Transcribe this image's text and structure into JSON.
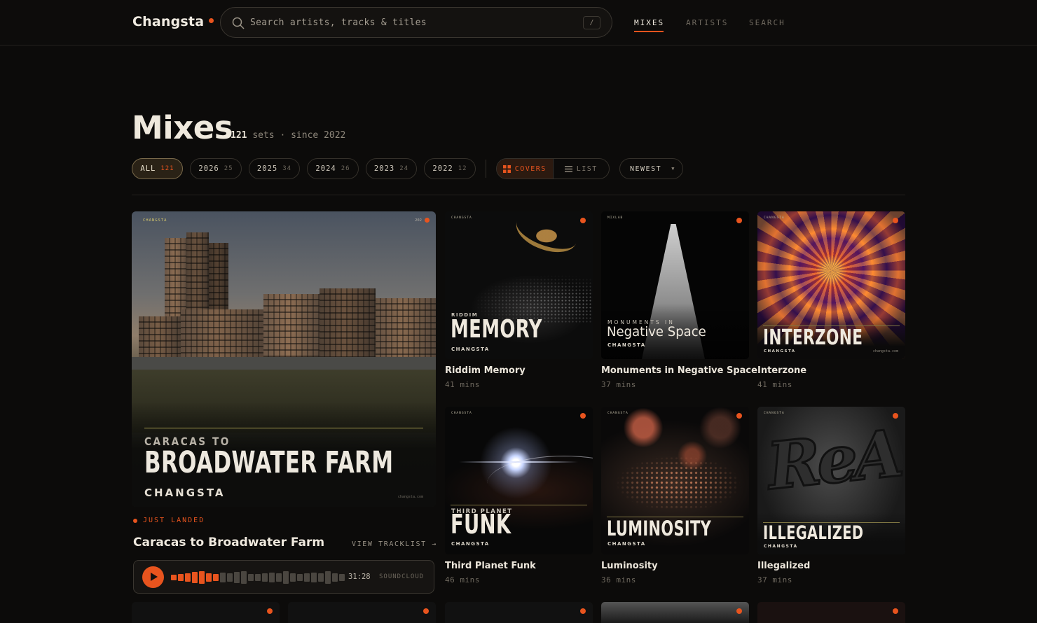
{
  "brand": {
    "name": "Changsta"
  },
  "search": {
    "placeholder": "Search artists, tracks & titles",
    "shortcut": "/"
  },
  "nav": [
    {
      "label": "MIXES",
      "active": true
    },
    {
      "label": "ARTISTS",
      "active": false
    },
    {
      "label": "SEARCH",
      "active": false
    }
  ],
  "header": {
    "title": "Mixes",
    "count": "121",
    "count_suffix": "sets · since 2022"
  },
  "filters": {
    "years": [
      {
        "label": "ALL",
        "count": "121",
        "active": true
      },
      {
        "label": "2026",
        "count": "25"
      },
      {
        "label": "2025",
        "count": "34"
      },
      {
        "label": "2024",
        "count": "26"
      },
      {
        "label": "2023",
        "count": "24"
      },
      {
        "label": "2022",
        "count": "12"
      }
    ],
    "view": {
      "covers": "COVERS",
      "list": "LIST",
      "active": "covers"
    },
    "sort": "NEWEST"
  },
  "featured": {
    "cover": {
      "tag": "CHANGSTA",
      "year": "202",
      "sup": "CARACAS TO",
      "main": "BROADWATER FARM",
      "artist": "CHANGSTA",
      "site": "changsta.com"
    },
    "badge": "JUST LANDED",
    "title": "Caracas to Broadwater Farm",
    "tracklist": "VIEW TRACKLIST →",
    "player": {
      "time": "31:28",
      "source": "SOUNDCLOUD",
      "progress": 0.27
    }
  },
  "mixes": [
    {
      "title": "Riddim Memory",
      "duration": "41 mins",
      "cover": {
        "tag": "CHANGSTA",
        "sup": "RIDDIM",
        "main": "MEMORY",
        "artist": "CHANGSTA"
      }
    },
    {
      "title": "Monuments in Negative Space",
      "duration": "37 mins",
      "cover": {
        "tag": "MIXLAB",
        "sup": "MONUMENTS IN",
        "main": "Negative Space",
        "artist": "CHANGSTA"
      }
    },
    {
      "title": "Interzone",
      "duration": "41 mins",
      "cover": {
        "tag": "CHANGSTA",
        "main": "INTERZONE",
        "artist": "CHANGSTA",
        "site": "changsta.com"
      }
    },
    {
      "title": "Third Planet Funk",
      "duration": "46 mins",
      "cover": {
        "tag": "CHANGSTA",
        "sup": "THIRD PLANET",
        "main": "FUNK",
        "artist": "CHANGSTA"
      }
    },
    {
      "title": "Luminosity",
      "duration": "36 mins",
      "cover": {
        "tag": "CHANGSTA",
        "main": "LUMINOSITY",
        "artist": "CHANGSTA"
      }
    },
    {
      "title": "Illegalized",
      "duration": "37 mins",
      "cover": {
        "tag": "CHANGSTA",
        "main": "ILLEGALIZED",
        "artist": "CHANGSTA"
      }
    }
  ],
  "colors": {
    "accent": "#e8541e",
    "background": "#0c0b0a",
    "text": "#e9e4da",
    "muted": "#6f695f"
  }
}
